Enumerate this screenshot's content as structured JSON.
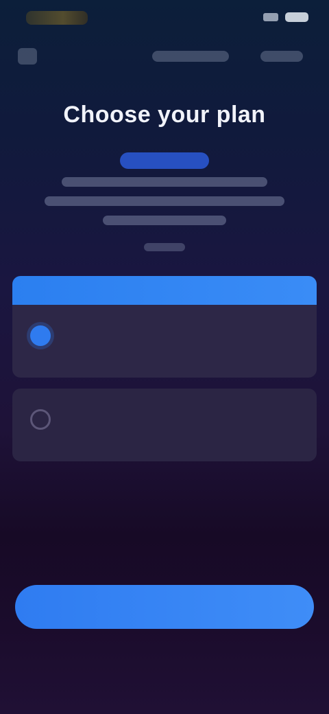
{
  "status_bar": {
    "time": "",
    "signal": "signal-icon",
    "battery": "battery-icon"
  },
  "nav": {
    "back_icon": "back-icon",
    "links": [
      "",
      ""
    ]
  },
  "header": {
    "title": "Choose your plan",
    "chip": "",
    "description": [
      "",
      "",
      ""
    ],
    "note": ""
  },
  "plans": {
    "banner": "",
    "items": [
      {
        "name": "",
        "sub": "",
        "price": "",
        "price_note": "",
        "selected": true
      },
      {
        "name": "",
        "sub": "",
        "price": "",
        "price_note": "",
        "selected": false
      }
    ]
  },
  "cta": {
    "label": ""
  },
  "footer": {
    "note": "",
    "links": [
      "",
      ""
    ]
  },
  "colors": {
    "accent": "#2f7cf1",
    "card": "#2d2747"
  }
}
